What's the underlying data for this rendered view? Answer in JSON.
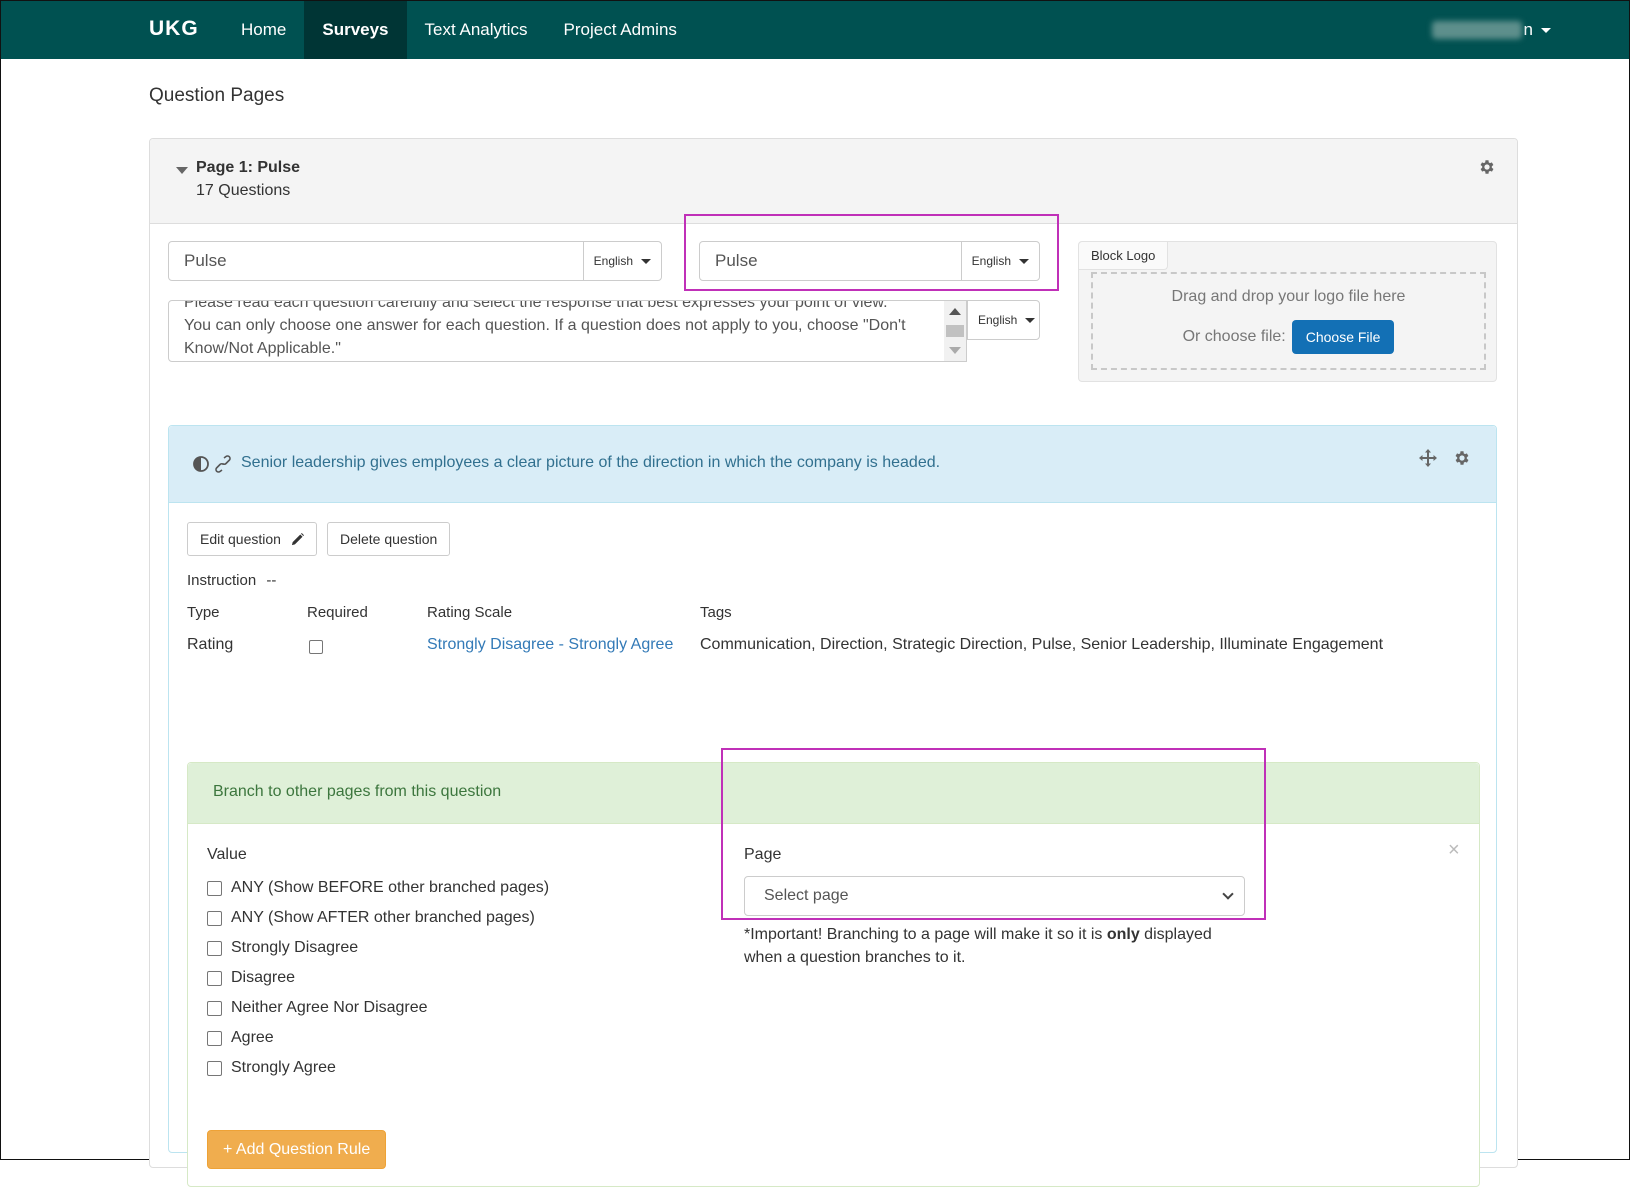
{
  "navbar": {
    "logo": "UKG",
    "items": [
      {
        "label": "Home",
        "active": false
      },
      {
        "label": "Surveys",
        "active": true
      },
      {
        "label": "Text Analytics",
        "active": false
      },
      {
        "label": "Project Admins",
        "active": false
      }
    ],
    "user_name_visible_suffix": "n"
  },
  "page_heading": "Question Pages",
  "page": {
    "title": "Page 1: Pulse",
    "question_count": "17 Questions",
    "name_input_value": "Pulse",
    "name_language": "English",
    "translated_name_value": "Pulse",
    "translated_language": "English",
    "description_text_partial": "Please read each question carefully and select the response that best expresses your point of view.",
    "description_text": "You can only choose one answer for each question. If a question does not apply to you, choose \"Don't Know/Not Applicable.\"",
    "description_language": "English"
  },
  "block_logo": {
    "tab_label": "Block Logo",
    "drop_text": "Drag and drop your logo file here",
    "choose_label": "Or choose file:",
    "choose_button": "Choose File"
  },
  "question": {
    "text": "Senior leadership gives employees a clear picture of the direction in which the company is headed.",
    "edit_button": "Edit question",
    "delete_button": "Delete question",
    "instruction_label": "Instruction",
    "instruction_value": "--",
    "columns": {
      "type_label": "Type",
      "required_label": "Required",
      "rating_scale_label": "Rating Scale",
      "tags_label": "Tags"
    },
    "type_value": "Rating",
    "required": false,
    "rating_scale_value": "Strongly Disagree - Strongly Agree",
    "tags_value": "Communication, Direction, Strategic Direction, Pulse, Senior Leadership, Illuminate Engagement"
  },
  "branch": {
    "title": "Branch to other pages from this question",
    "value_label": "Value",
    "options": [
      {
        "label": "ANY (Show BEFORE other branched pages)",
        "checked": false
      },
      {
        "label": "ANY (Show AFTER other branched pages)",
        "checked": false
      },
      {
        "label": "Strongly Disagree",
        "checked": false
      },
      {
        "label": "Disagree",
        "checked": false
      },
      {
        "label": "Neither Agree Nor Disagree",
        "checked": false
      },
      {
        "label": "Agree",
        "checked": false
      },
      {
        "label": "Strongly Agree",
        "checked": false
      }
    ],
    "page_label": "Page",
    "page_select_placeholder": "Select page",
    "note_before": "*Important! Branching to a page will make it so it is ",
    "note_bold": "only",
    "note_after": " displayed when a question branches to it.",
    "add_rule_button": "+ Add Question Rule",
    "close_symbol": "×"
  },
  "colors": {
    "navbar": "#005151",
    "navbar_active": "#003535",
    "highlight": "#c030b8",
    "primary": "#1370b5",
    "warning": "#f0ad4e",
    "info_bg": "#d9edf7",
    "success_bg": "#dff0d8"
  }
}
